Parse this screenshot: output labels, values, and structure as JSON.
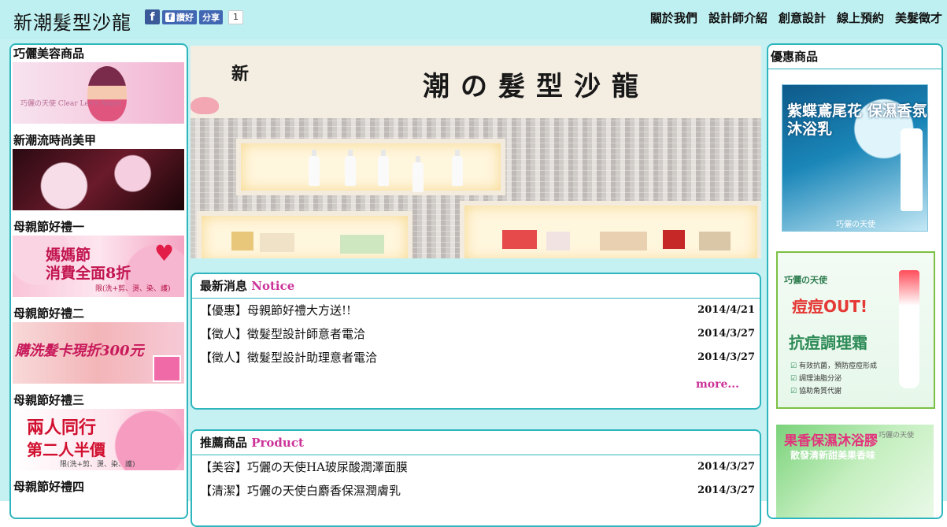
{
  "header": {
    "site_title": "新潮髮型沙龍",
    "fb_icon": "f",
    "fb_like": "讚好",
    "fb_share": "分享",
    "fb_count": "1",
    "nav": [
      "關於我們",
      "設計師介紹",
      "創意設計",
      "線上預約",
      "美髮徵才"
    ]
  },
  "left": {
    "promos": [
      {
        "title": "巧儷美容商品",
        "img_text": "巧儷の天使 Clear Lee's Angel"
      },
      {
        "title": "新潮流時尚美甲"
      },
      {
        "title": "母親節好禮一",
        "img_line1": "媽媽節",
        "img_line2": "消費全面8折",
        "img_line3": "限(洗+剪、燙、染、護)"
      },
      {
        "title": "母親節好禮二",
        "img_line1": "購洗髮卡現折300元"
      },
      {
        "title": "母親節好禮三",
        "img_line1": "兩人同行",
        "img_line2": "第二人半價",
        "img_line3": "限(洗+剪、燙、染、護)"
      },
      {
        "title": "母親節好禮四"
      }
    ]
  },
  "hero": {
    "sign_small": "新",
    "sign": "潮の髮型沙龍"
  },
  "news": {
    "title": "最新消息",
    "title_en": "Notice",
    "items": [
      {
        "text": "【優惠】母親節好禮大方送!!",
        "date": "2014/4/21"
      },
      {
        "text": "【徵人】徵髮型設計師意者電洽",
        "date": "2014/3/27"
      },
      {
        "text": "【徵人】徵髮型設計助理意者電洽",
        "date": "2014/3/27"
      }
    ],
    "more": "more..."
  },
  "products": {
    "title": "推薦商品",
    "title_en": "Product",
    "items": [
      {
        "text": "【美容】巧儷の天使HA玻尿酸潤澤面膜",
        "date": "2014/3/27"
      },
      {
        "text": "【清潔】巧儷の天使白麝香保濕潤膚乳",
        "date": "2014/3/27"
      }
    ]
  },
  "right": {
    "title": "優惠商品",
    "ad1": {
      "headline": "紫蝶鳶尾花 保濕香氛沐浴乳",
      "brand": "巧儷の天使"
    },
    "ad2": {
      "logo": "巧儷の天使",
      "out": "痘痘OUT!",
      "cream": "抗痘調理霜",
      "bullets": [
        "有效抗菌，預防痘痘形成",
        "調理油脂分泌",
        "協助角質代謝"
      ]
    },
    "ad3": {
      "headline": "果香保濕沐浴膠",
      "sub": "散發清新甜美果香味",
      "brand": "巧儷の天使"
    }
  },
  "colors": {
    "accent": "#2fb5bd",
    "pink": "#cc3399",
    "band": "#c6f1f3"
  }
}
